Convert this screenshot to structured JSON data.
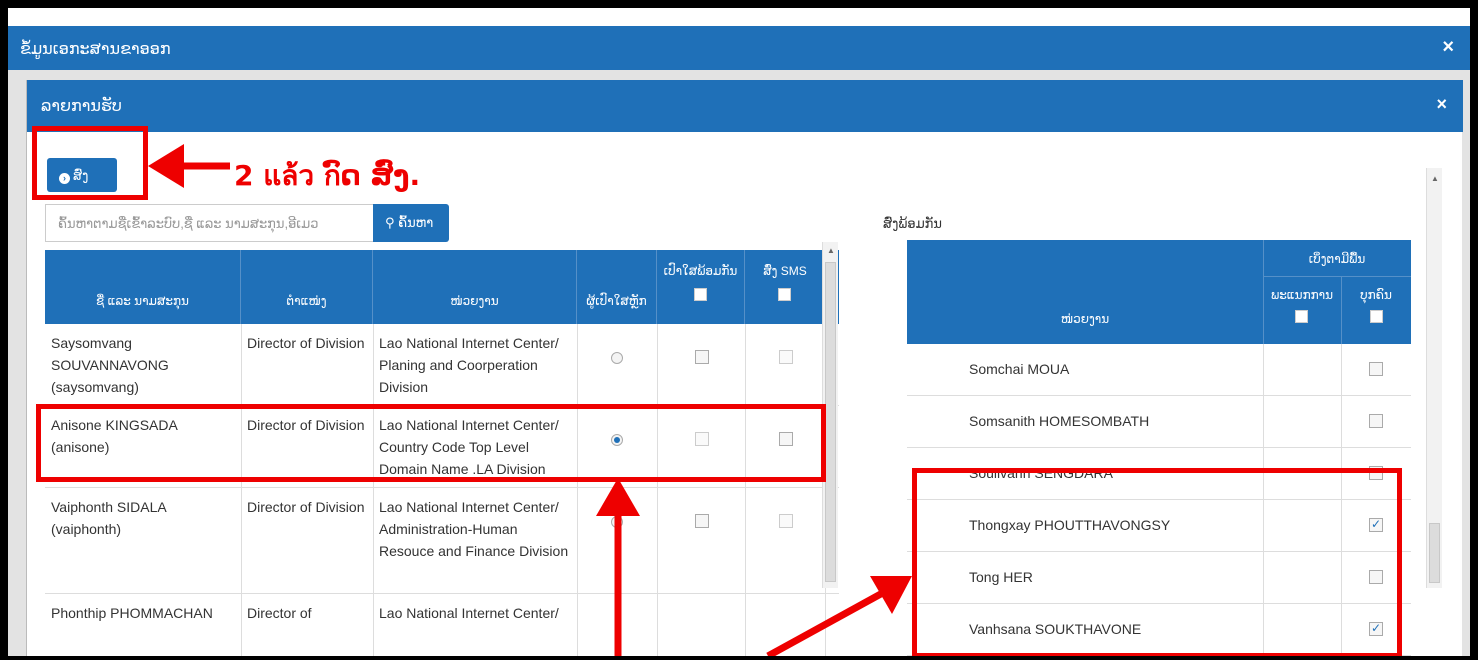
{
  "outer_dialog": {
    "title": "ຂໍ້ມູນເອກະສານຂາອອກ",
    "close_glyph": "×"
  },
  "inner_dialog": {
    "title": "ລາຍການຮັບ",
    "close_glyph": "×"
  },
  "send_button": {
    "label": "ສົ່ງ"
  },
  "search": {
    "placeholder": "ຄົ້ນຫາຕາມຊື່ເຂົ້າລະບົບ,ຊື່ ແລະ ນາມສະກຸນ,ອີເມວ",
    "button_label": "ຄົ້ນຫາ"
  },
  "available_label": "ສົ່ງພ້ອມກັນ",
  "left_table": {
    "headers": {
      "name": "ຊື່ ແລະ ນາມສະກຸນ",
      "position": "ຕໍາແໜ່ງ",
      "unit": "ໜ່ວຍງານ",
      "main_recipient": "ຜູ້ເປົາໃສຫຼັກ",
      "cc": "ເປົາໃສພ້ອມກັນ",
      "sms": "ສົ່ງ SMS"
    },
    "rows": [
      {
        "name": "Saysomvang SOUVANNAVONG (saysomvang)",
        "position": "Director of Division",
        "unit": "Lao National Internet Center/ Planing and Coorperation Division",
        "main": false,
        "cc": false,
        "sms": false
      },
      {
        "name": "Anisone KINGSADA (anisone)",
        "position": "Director of Division",
        "unit": "Lao National Internet Center/ Country Code Top Level Domain Name .LA Division",
        "main": true,
        "cc": false,
        "sms": false
      },
      {
        "name": "Vaiphonth SIDALA (vaiphonth)",
        "position": "Director of Division",
        "unit": "Lao National Internet Center/ Administration-Human Resouce and Finance Division",
        "main": false,
        "cc": false,
        "sms": false
      },
      {
        "name": "Phonthip PHOMMACHAN",
        "position": "Director of",
        "unit": "Lao National Internet Center/",
        "main": false,
        "cc": false,
        "sms": false
      }
    ]
  },
  "right_table": {
    "headers": {
      "group": "ເບິ່ງຕາມີພື້ນ",
      "unit": "ໜ່ວຍງານ",
      "col_a": "ພະແນກການ",
      "col_b": "ບຸກຄົນ"
    },
    "rows": [
      {
        "name": "Somchai MOUA",
        "checked": false
      },
      {
        "name": "Somsanith HOMESOMBATH",
        "checked": false
      },
      {
        "name": "Soulivanh SENGDARA",
        "checked": false
      },
      {
        "name": "Thongxay PHOUTTHAVONGSY",
        "checked": true
      },
      {
        "name": "Tong HER",
        "checked": false
      },
      {
        "name": "Vanhsana SOUKTHAVONE",
        "checked": true
      }
    ]
  },
  "annotation": {
    "text": "2 แล้ว กົດ ສົ່ງ.",
    "color": "#e00000"
  },
  "colors": {
    "header_blue": "#1f70b8"
  }
}
